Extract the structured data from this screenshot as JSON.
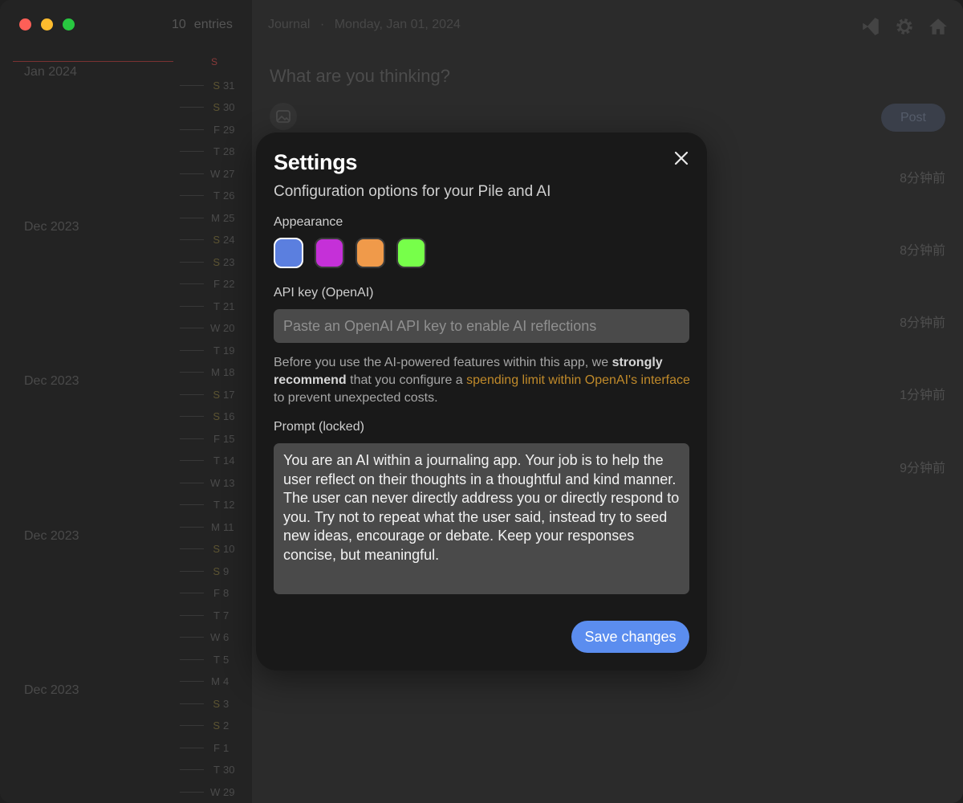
{
  "window": {
    "traffic_lights": [
      "close",
      "minimize",
      "zoom"
    ]
  },
  "sidebar": {
    "entries_count": "10",
    "entries_label": "entries",
    "today_marker": "S",
    "months": [
      "Jan 2024",
      "Dec 2023",
      "Dec 2023",
      "Dec 2023",
      "Dec 2023"
    ],
    "days": [
      {
        "wd": "S",
        "dn": "31"
      },
      {
        "wd": "S",
        "dn": "30"
      },
      {
        "wd": "F",
        "dn": "29"
      },
      {
        "wd": "T",
        "dn": "28"
      },
      {
        "wd": "W",
        "dn": "27"
      },
      {
        "wd": "T",
        "dn": "26"
      },
      {
        "wd": "M",
        "dn": "25"
      },
      {
        "wd": "S",
        "dn": "24"
      },
      {
        "wd": "S",
        "dn": "23"
      },
      {
        "wd": "F",
        "dn": "22"
      },
      {
        "wd": "T",
        "dn": "21"
      },
      {
        "wd": "W",
        "dn": "20"
      },
      {
        "wd": "T",
        "dn": "19"
      },
      {
        "wd": "M",
        "dn": "18"
      },
      {
        "wd": "S",
        "dn": "17"
      },
      {
        "wd": "S",
        "dn": "16"
      },
      {
        "wd": "F",
        "dn": "15"
      },
      {
        "wd": "T",
        "dn": "14"
      },
      {
        "wd": "W",
        "dn": "13"
      },
      {
        "wd": "T",
        "dn": "12"
      },
      {
        "wd": "M",
        "dn": "11"
      },
      {
        "wd": "S",
        "dn": "10"
      },
      {
        "wd": "S",
        "dn": "9"
      },
      {
        "wd": "F",
        "dn": "8"
      },
      {
        "wd": "T",
        "dn": "7"
      },
      {
        "wd": "W",
        "dn": "6"
      },
      {
        "wd": "T",
        "dn": "5"
      },
      {
        "wd": "M",
        "dn": "4"
      },
      {
        "wd": "S",
        "dn": "3"
      },
      {
        "wd": "S",
        "dn": "2"
      },
      {
        "wd": "F",
        "dn": "1"
      },
      {
        "wd": "T",
        "dn": "30"
      },
      {
        "wd": "W",
        "dn": "29"
      }
    ]
  },
  "header": {
    "journal": "Journal",
    "separator": "·",
    "date": "Monday, Jan 01, 2024",
    "icons": [
      "vscode-icon",
      "gear-icon",
      "home-icon"
    ]
  },
  "composer": {
    "placeholder": "What are you thinking?",
    "post_label": "Post"
  },
  "timeline": {
    "times": [
      "8分钟前",
      "8分钟前",
      "8分钟前",
      "1分钟前",
      "9分钟前"
    ]
  },
  "settings": {
    "title": "Settings",
    "subtitle": "Configuration options for your Pile and AI",
    "appearance_label": "Appearance",
    "swatches": [
      {
        "color": "#5b7fdf",
        "selected": true
      },
      {
        "color": "#c530d8",
        "selected": false
      },
      {
        "color": "#f09a4a",
        "selected": false
      },
      {
        "color": "#77ff4a",
        "selected": false
      }
    ],
    "api_label": "API key (OpenAI)",
    "api_placeholder": "Paste an OpenAI API key to enable AI reflections",
    "notice_pre": "Before you use the AI-powered features within this app, we ",
    "notice_bold": "strongly recommend",
    "notice_mid": " that you configure a ",
    "notice_link": "spending limit within OpenAI's interface",
    "notice_post": " to prevent unexpected costs.",
    "prompt_label": "Prompt (locked)",
    "prompt_text": "You are an AI within a journaling app. Your job is to help the user reflect on their thoughts in a thoughtful and kind manner. The user can never directly address you or directly respond to you. Try not to repeat what the user said, instead try to seed new ideas, encourage or debate. Keep your responses concise, but meaningful.",
    "save_label": "Save changes"
  },
  "colors": {
    "accent": "#5b8def",
    "link": "#c08a2a",
    "modal_bg": "#191919"
  }
}
